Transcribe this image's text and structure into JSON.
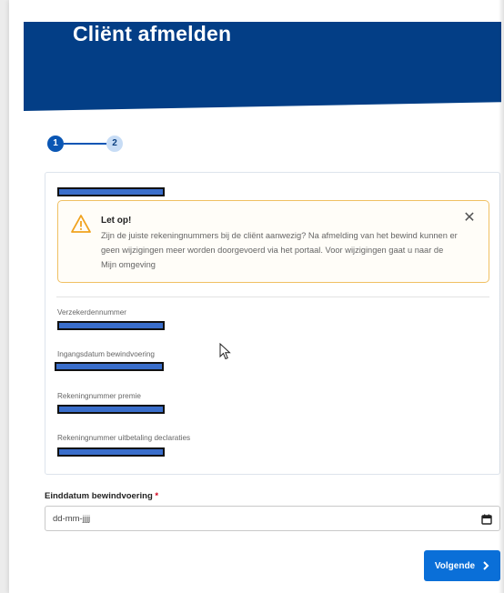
{
  "header": {
    "title": "Cliënt afmelden"
  },
  "stepper": {
    "steps": [
      {
        "label": "1"
      },
      {
        "label": "2"
      }
    ],
    "current": 1
  },
  "alert": {
    "icon": "warning-icon",
    "title": "Let op!",
    "body": "Zijn de juiste rekeningnummers bij de cliënt aanwezig? Na afmelding van het bewind kunnen er geen wijzigingen meer worden doorgevoerd via het portaal. Voor wijzigingen gaat u naar de Mijn omgeving",
    "close_icon": "close-icon"
  },
  "fields": [
    {
      "label": "Verzekerdennummer"
    },
    {
      "label": "Ingangsdatum bewindvoering"
    },
    {
      "label": "Rekeningnummer premie"
    },
    {
      "label": "Rekeningnummer uitbetaling declaraties"
    }
  ],
  "end_date": {
    "label": "Einddatum bewindvoering",
    "required_mark": "*",
    "placeholder": "dd-mm-jjjj",
    "icon": "calendar-icon"
  },
  "next_button": {
    "label": "Volgende",
    "icon": "chevron-right-icon"
  },
  "colors": {
    "banner": "#033e86",
    "primary": "#0a56b4",
    "button": "#0a6fd8",
    "alert_border": "#f0c063",
    "alert_icon": "#f0a21e",
    "required": "#d0021b"
  }
}
